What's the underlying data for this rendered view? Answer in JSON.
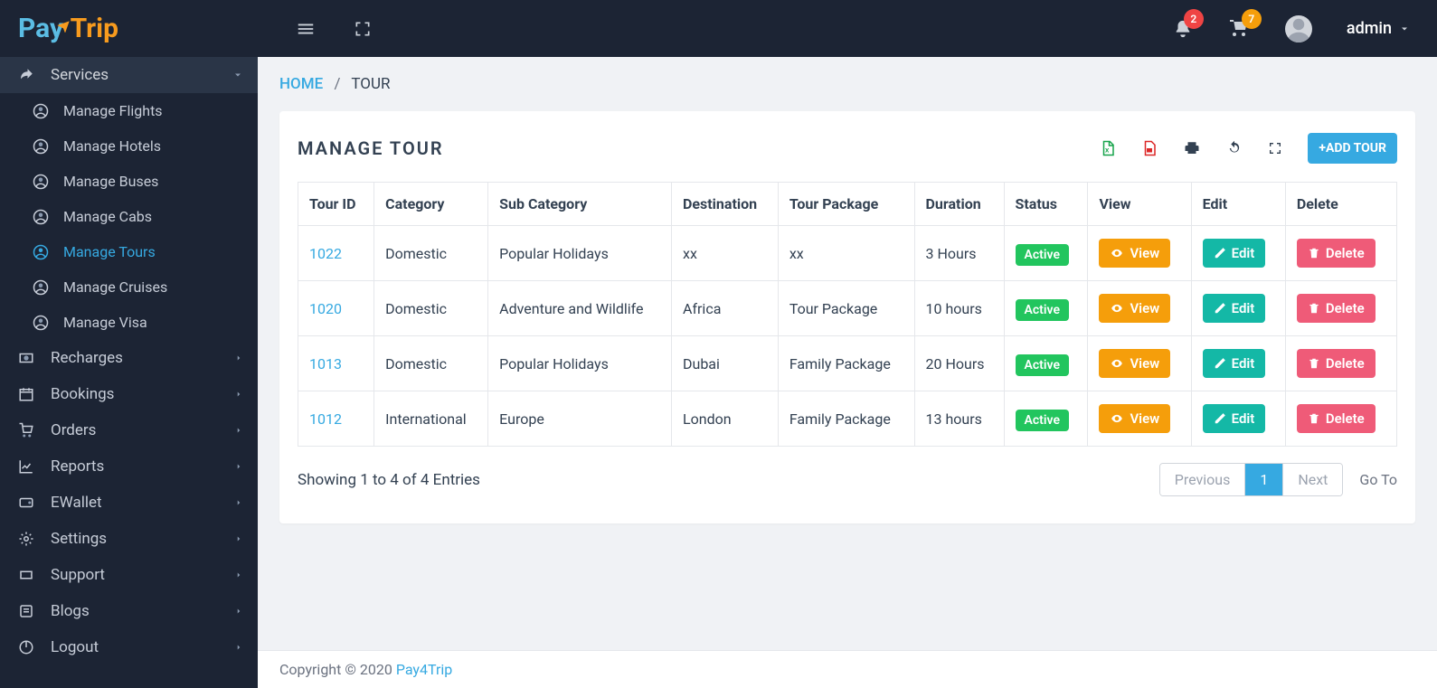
{
  "header": {
    "logo": {
      "p1": "Pay",
      "p2": "Trip"
    },
    "notifications_count": "2",
    "cart_count": "7",
    "user_name": "admin"
  },
  "sidebar": {
    "services_label": "Services",
    "services_items": [
      {
        "label": "Manage Flights",
        "active": false
      },
      {
        "label": "Manage Hotels",
        "active": false
      },
      {
        "label": "Manage Buses",
        "active": false
      },
      {
        "label": "Manage Cabs",
        "active": false
      },
      {
        "label": "Manage Tours",
        "active": true
      },
      {
        "label": "Manage Cruises",
        "active": false
      },
      {
        "label": "Manage Visa",
        "active": false
      }
    ],
    "other": [
      {
        "label": "Recharges",
        "icon": "cash"
      },
      {
        "label": "Bookings",
        "icon": "calendar"
      },
      {
        "label": "Orders",
        "icon": "cart"
      },
      {
        "label": "Reports",
        "icon": "chart"
      },
      {
        "label": "EWallet",
        "icon": "wallet"
      },
      {
        "label": "Settings",
        "icon": "gear"
      },
      {
        "label": "Support",
        "icon": "ticket"
      },
      {
        "label": "Blogs",
        "icon": "blog"
      },
      {
        "label": "Logout",
        "icon": "power"
      }
    ]
  },
  "breadcrumb": {
    "home": "HOME",
    "current": "TOUR"
  },
  "card": {
    "title": "MANAGE TOUR",
    "add_label": "+ADD TOUR",
    "headers": [
      "Tour ID",
      "Category",
      "Sub Category",
      "Destination",
      "Tour Package",
      "Duration",
      "Status",
      "View",
      "Edit",
      "Delete"
    ],
    "rows": [
      {
        "id": "1022",
        "category": "Domestic",
        "sub": "Popular Holidays",
        "dest": "xx",
        "pkg": "xx",
        "dur": "3 Hours",
        "status": "Active"
      },
      {
        "id": "1020",
        "category": "Domestic",
        "sub": "Adventure and Wildlife",
        "dest": "Africa",
        "pkg": "Tour Package",
        "dur": "10 hours",
        "status": "Active"
      },
      {
        "id": "1013",
        "category": "Domestic",
        "sub": "Popular Holidays",
        "dest": "Dubai",
        "pkg": "Family Package",
        "dur": "20 Hours",
        "status": "Active"
      },
      {
        "id": "1012",
        "category": "International",
        "sub": "Europe",
        "dest": "London",
        "pkg": "Family Package",
        "dur": "13 hours",
        "status": "Active"
      }
    ],
    "actions": {
      "view": "View",
      "edit": "Edit",
      "delete": "Delete"
    },
    "showing": "Showing 1 to 4 of 4 Entries",
    "pager": {
      "prev": "Previous",
      "page": "1",
      "next": "Next",
      "goto": "Go To"
    }
  },
  "footer": {
    "text": "Copyright © 2020 ",
    "brand": "Pay4Trip"
  }
}
